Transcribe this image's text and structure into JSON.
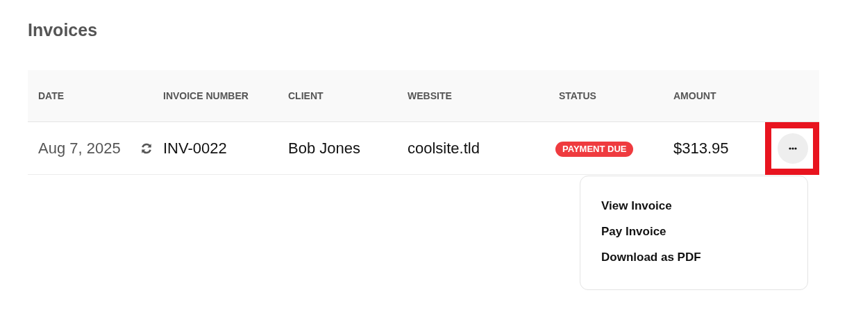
{
  "page": {
    "title": "Invoices"
  },
  "table": {
    "columns": [
      "DATE",
      "INVOICE NUMBER",
      "CLIENT",
      "WEBSITE",
      "STATUS",
      "AMOUNT"
    ],
    "rows": [
      {
        "date": "Aug 7, 2025",
        "recurring": true,
        "invoice_number": "INV-0022",
        "client": "Bob Jones",
        "website": "coolsite.tld",
        "status": {
          "label": "PAYMENT DUE",
          "kind": "due"
        },
        "amount": "$313.95",
        "actions_highlighted": true,
        "menu_open": true
      }
    ]
  },
  "actions_menu": {
    "items": [
      "View Invoice",
      "Pay Invoice",
      "Download as PDF"
    ]
  }
}
